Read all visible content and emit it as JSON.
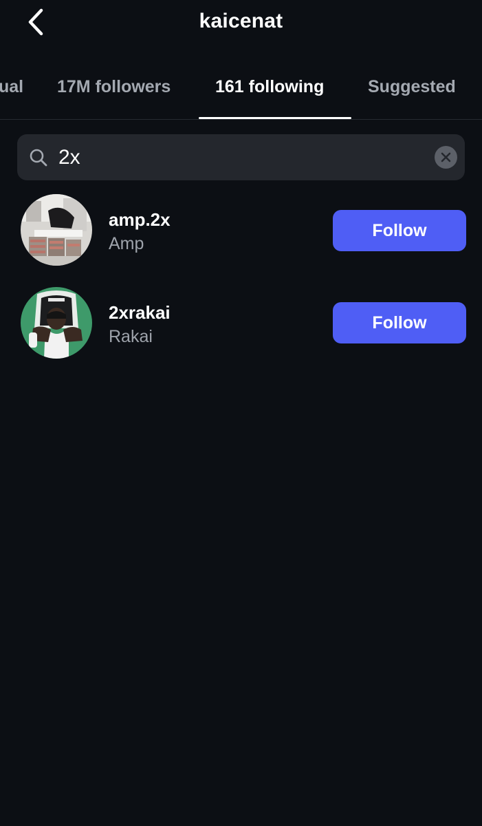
{
  "header": {
    "title": "kaicenat",
    "back_icon": "chevron-left-icon"
  },
  "tabs": [
    {
      "label": "ual",
      "active": false
    },
    {
      "label": "17M followers",
      "active": false
    },
    {
      "label": "161 following",
      "active": true
    },
    {
      "label": "Suggested",
      "active": false
    }
  ],
  "search": {
    "value": "2x",
    "icon": "search-icon",
    "clear_icon": "clear-icon"
  },
  "users": [
    {
      "username": "amp.2x",
      "display_name": "Amp",
      "button_label": "Follow"
    },
    {
      "username": "2xrakai",
      "display_name": "Rakai",
      "button_label": "Follow"
    }
  ],
  "colors": {
    "background": "#0c0f14",
    "search_bg": "#24272d",
    "accent": "#4f5ef5",
    "muted_text": "#9ea3ab"
  }
}
